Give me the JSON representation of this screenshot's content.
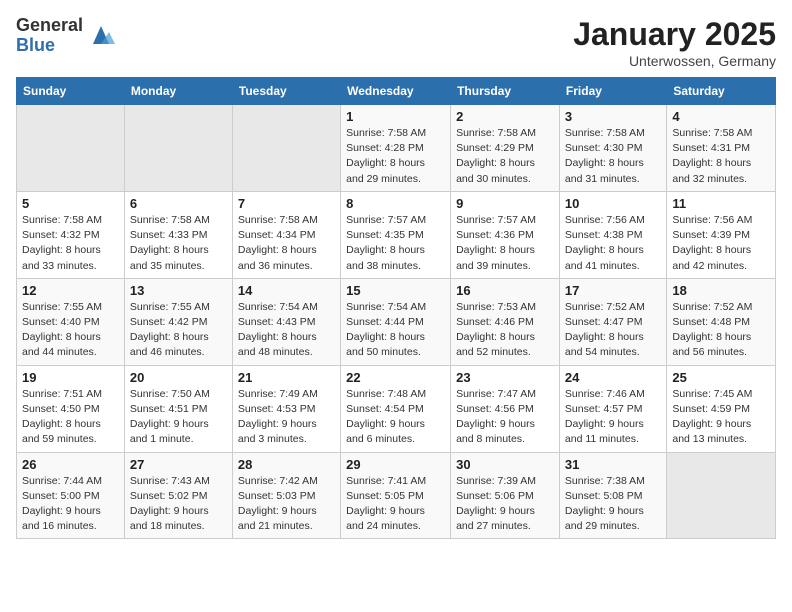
{
  "header": {
    "logo_general": "General",
    "logo_blue": "Blue",
    "title": "January 2025",
    "subtitle": "Unterwossen, Germany"
  },
  "weekdays": [
    "Sunday",
    "Monday",
    "Tuesday",
    "Wednesday",
    "Thursday",
    "Friday",
    "Saturday"
  ],
  "weeks": [
    [
      {
        "day": "",
        "empty": true
      },
      {
        "day": "",
        "empty": true
      },
      {
        "day": "",
        "empty": true
      },
      {
        "day": "1",
        "sunrise": "7:58 AM",
        "sunset": "4:28 PM",
        "daylight": "8 hours and 29 minutes."
      },
      {
        "day": "2",
        "sunrise": "7:58 AM",
        "sunset": "4:29 PM",
        "daylight": "8 hours and 30 minutes."
      },
      {
        "day": "3",
        "sunrise": "7:58 AM",
        "sunset": "4:30 PM",
        "daylight": "8 hours and 31 minutes."
      },
      {
        "day": "4",
        "sunrise": "7:58 AM",
        "sunset": "4:31 PM",
        "daylight": "8 hours and 32 minutes."
      }
    ],
    [
      {
        "day": "5",
        "sunrise": "7:58 AM",
        "sunset": "4:32 PM",
        "daylight": "8 hours and 33 minutes."
      },
      {
        "day": "6",
        "sunrise": "7:58 AM",
        "sunset": "4:33 PM",
        "daylight": "8 hours and 35 minutes."
      },
      {
        "day": "7",
        "sunrise": "7:58 AM",
        "sunset": "4:34 PM",
        "daylight": "8 hours and 36 minutes."
      },
      {
        "day": "8",
        "sunrise": "7:57 AM",
        "sunset": "4:35 PM",
        "daylight": "8 hours and 38 minutes."
      },
      {
        "day": "9",
        "sunrise": "7:57 AM",
        "sunset": "4:36 PM",
        "daylight": "8 hours and 39 minutes."
      },
      {
        "day": "10",
        "sunrise": "7:56 AM",
        "sunset": "4:38 PM",
        "daylight": "8 hours and 41 minutes."
      },
      {
        "day": "11",
        "sunrise": "7:56 AM",
        "sunset": "4:39 PM",
        "daylight": "8 hours and 42 minutes."
      }
    ],
    [
      {
        "day": "12",
        "sunrise": "7:55 AM",
        "sunset": "4:40 PM",
        "daylight": "8 hours and 44 minutes."
      },
      {
        "day": "13",
        "sunrise": "7:55 AM",
        "sunset": "4:42 PM",
        "daylight": "8 hours and 46 minutes."
      },
      {
        "day": "14",
        "sunrise": "7:54 AM",
        "sunset": "4:43 PM",
        "daylight": "8 hours and 48 minutes."
      },
      {
        "day": "15",
        "sunrise": "7:54 AM",
        "sunset": "4:44 PM",
        "daylight": "8 hours and 50 minutes."
      },
      {
        "day": "16",
        "sunrise": "7:53 AM",
        "sunset": "4:46 PM",
        "daylight": "8 hours and 52 minutes."
      },
      {
        "day": "17",
        "sunrise": "7:52 AM",
        "sunset": "4:47 PM",
        "daylight": "8 hours and 54 minutes."
      },
      {
        "day": "18",
        "sunrise": "7:52 AM",
        "sunset": "4:48 PM",
        "daylight": "8 hours and 56 minutes."
      }
    ],
    [
      {
        "day": "19",
        "sunrise": "7:51 AM",
        "sunset": "4:50 PM",
        "daylight": "8 hours and 59 minutes."
      },
      {
        "day": "20",
        "sunrise": "7:50 AM",
        "sunset": "4:51 PM",
        "daylight": "9 hours and 1 minute."
      },
      {
        "day": "21",
        "sunrise": "7:49 AM",
        "sunset": "4:53 PM",
        "daylight": "9 hours and 3 minutes."
      },
      {
        "day": "22",
        "sunrise": "7:48 AM",
        "sunset": "4:54 PM",
        "daylight": "9 hours and 6 minutes."
      },
      {
        "day": "23",
        "sunrise": "7:47 AM",
        "sunset": "4:56 PM",
        "daylight": "9 hours and 8 minutes."
      },
      {
        "day": "24",
        "sunrise": "7:46 AM",
        "sunset": "4:57 PM",
        "daylight": "9 hours and 11 minutes."
      },
      {
        "day": "25",
        "sunrise": "7:45 AM",
        "sunset": "4:59 PM",
        "daylight": "9 hours and 13 minutes."
      }
    ],
    [
      {
        "day": "26",
        "sunrise": "7:44 AM",
        "sunset": "5:00 PM",
        "daylight": "9 hours and 16 minutes."
      },
      {
        "day": "27",
        "sunrise": "7:43 AM",
        "sunset": "5:02 PM",
        "daylight": "9 hours and 18 minutes."
      },
      {
        "day": "28",
        "sunrise": "7:42 AM",
        "sunset": "5:03 PM",
        "daylight": "9 hours and 21 minutes."
      },
      {
        "day": "29",
        "sunrise": "7:41 AM",
        "sunset": "5:05 PM",
        "daylight": "9 hours and 24 minutes."
      },
      {
        "day": "30",
        "sunrise": "7:39 AM",
        "sunset": "5:06 PM",
        "daylight": "9 hours and 27 minutes."
      },
      {
        "day": "31",
        "sunrise": "7:38 AM",
        "sunset": "5:08 PM",
        "daylight": "9 hours and 29 minutes."
      },
      {
        "day": "",
        "empty": true
      }
    ]
  ],
  "labels": {
    "sunrise": "Sunrise:",
    "sunset": "Sunset:",
    "daylight": "Daylight:"
  }
}
